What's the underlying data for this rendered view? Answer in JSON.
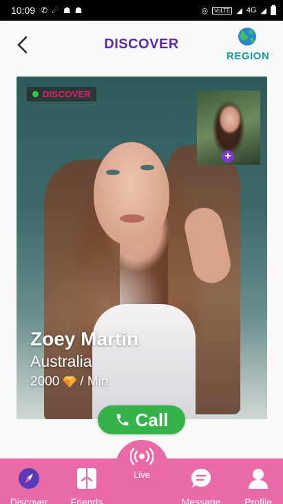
{
  "status_bar": {
    "time": "10:09",
    "network": "4G"
  },
  "header": {
    "title": "DISCOVER",
    "region_label": "REGION"
  },
  "card": {
    "badge": "DISCOVER",
    "name": "Zoey Martin",
    "country": "Australia",
    "rate_amount": "2000",
    "rate_unit": "/ Min"
  },
  "call_button": {
    "label": "Call"
  },
  "nav": {
    "items": [
      {
        "label": "Discover",
        "icon": "compass-icon"
      },
      {
        "label": "Friends",
        "icon": "friends-icon"
      },
      {
        "label": "Live",
        "icon": "live-broadcast-icon"
      },
      {
        "label": "Message",
        "icon": "message-icon"
      },
      {
        "label": "Profile",
        "icon": "profile-icon"
      }
    ]
  },
  "colors": {
    "title": "#5b2aa0",
    "region": "#149a9a",
    "nav_bg": "#e86ba7",
    "call_green": "#34b34a",
    "badge_text": "#e0206f"
  }
}
